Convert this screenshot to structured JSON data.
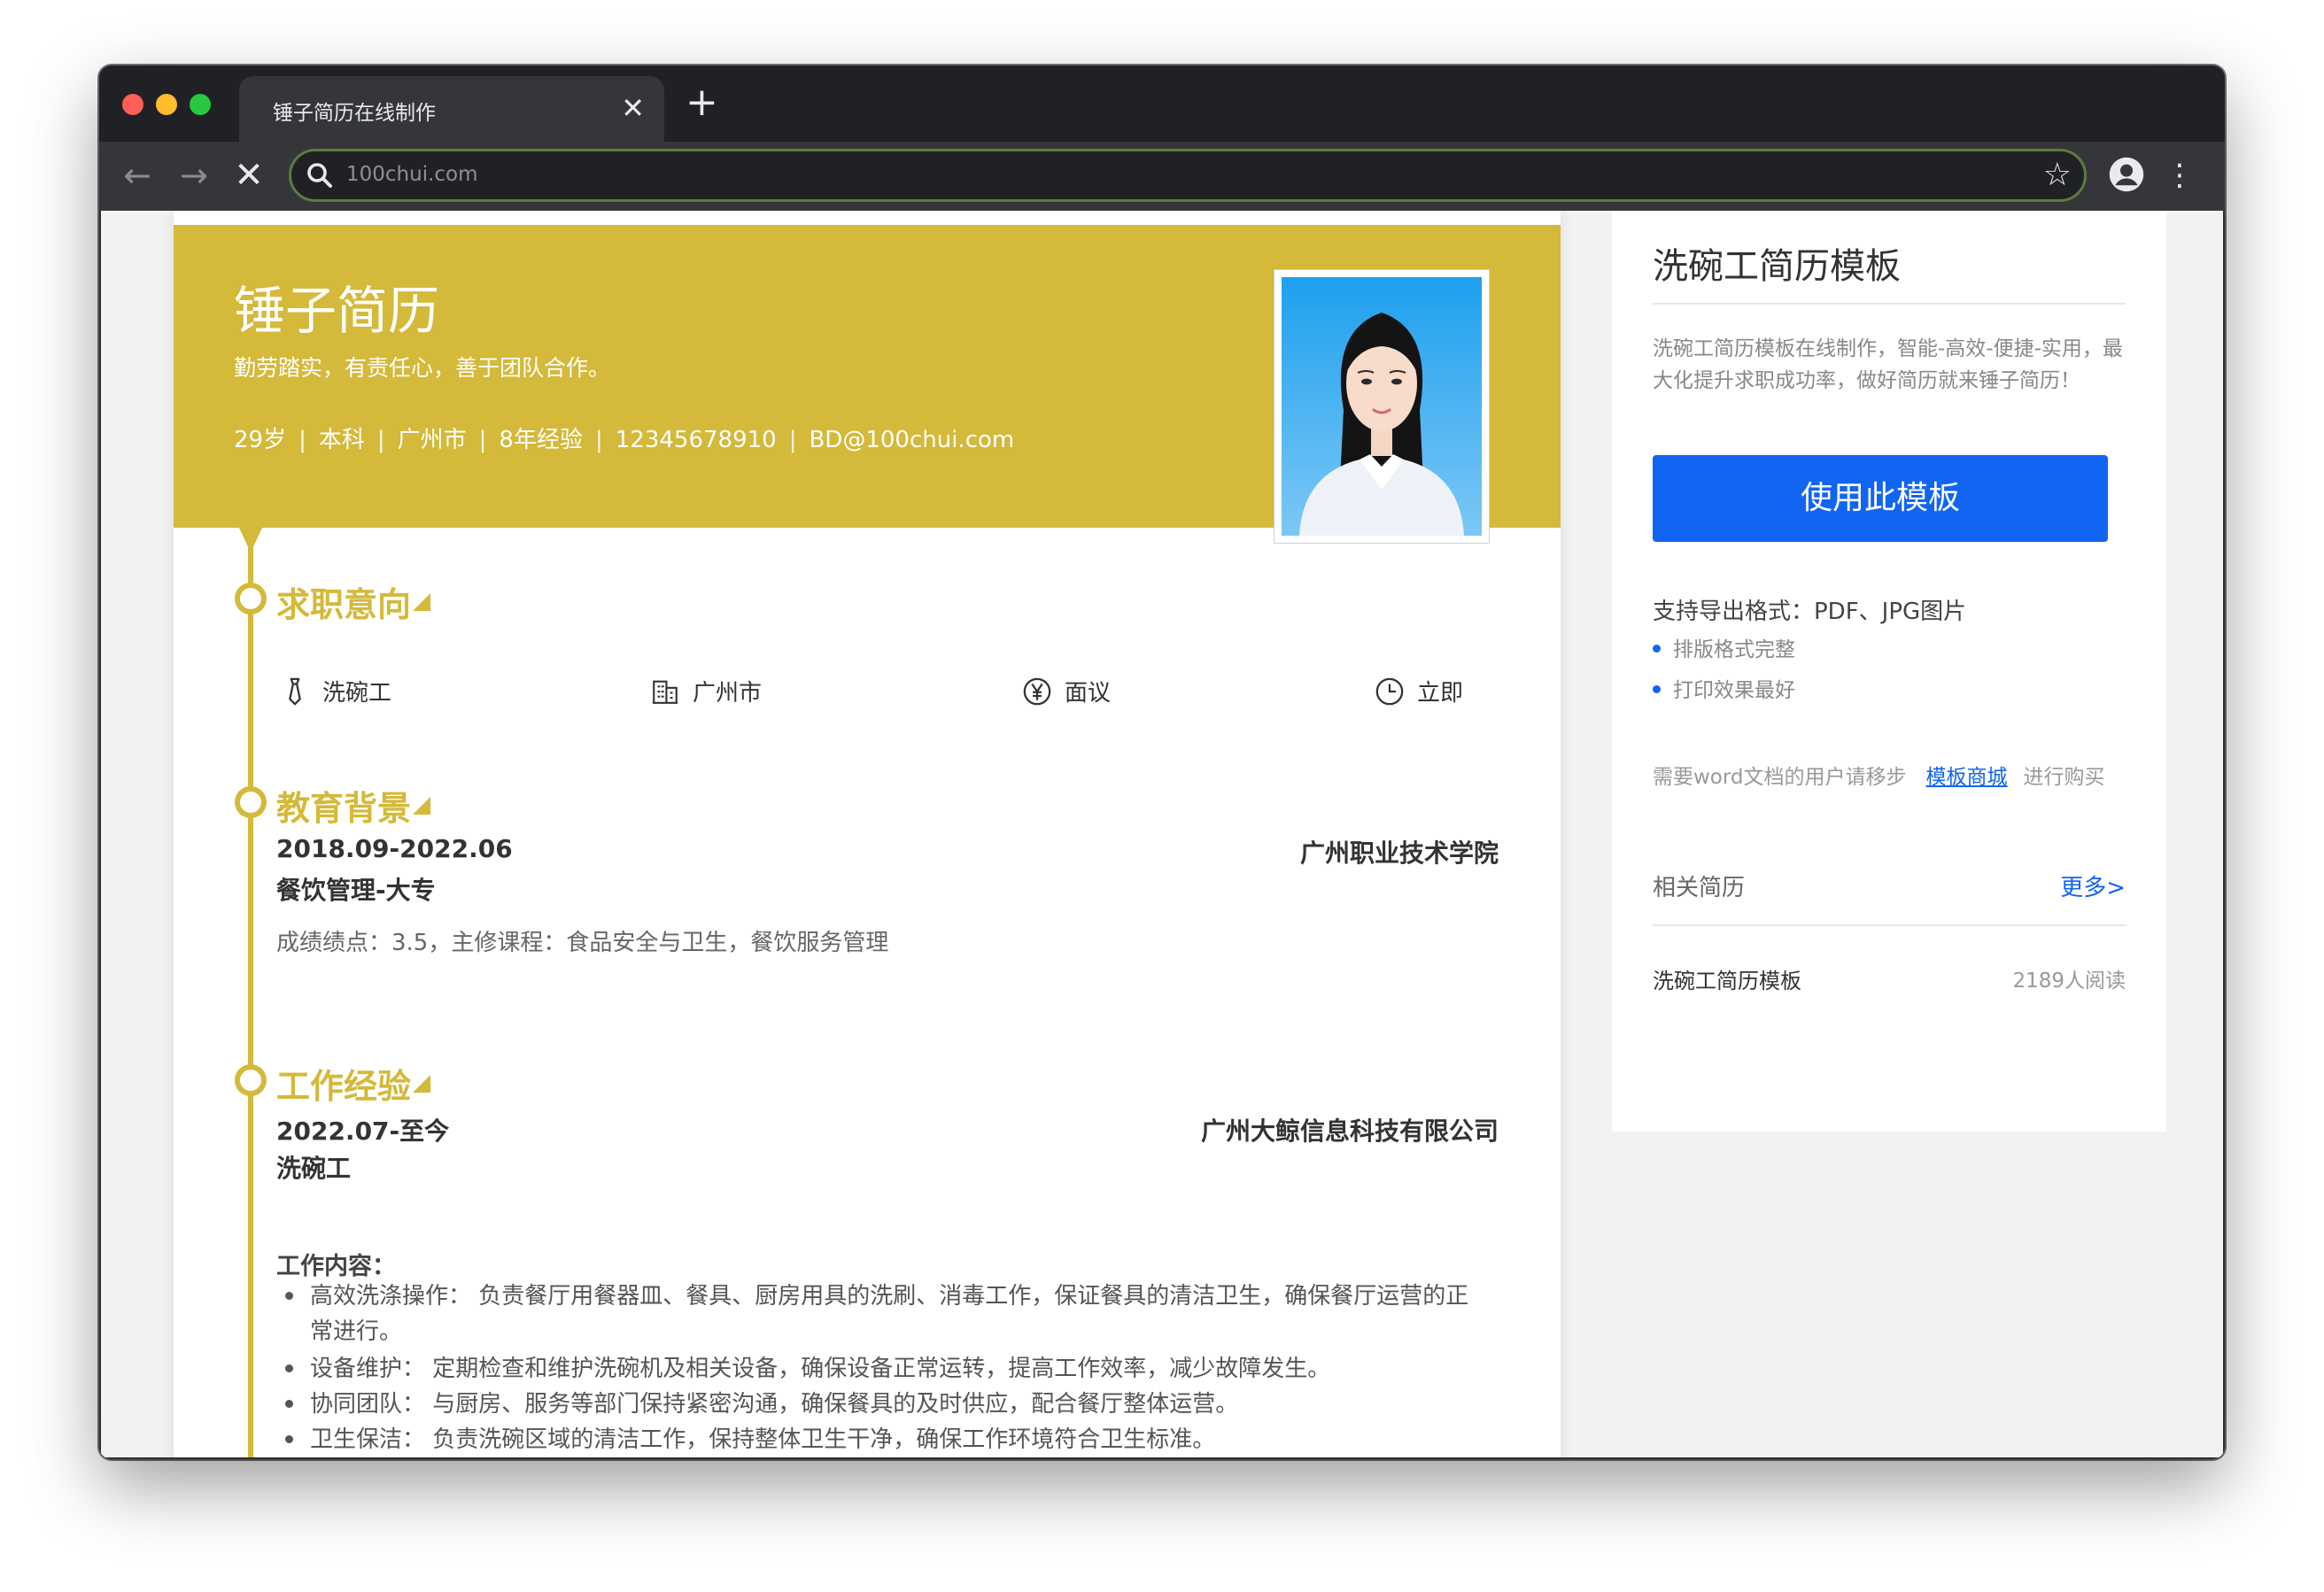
{
  "browser": {
    "tab_title": "锤子简历在线制作",
    "tab_close": "✕",
    "new_tab": "+",
    "address": "100chui.com",
    "back": "←",
    "forward": "→",
    "stop": "✕",
    "star": "☆",
    "menu": "⋮",
    "omnibox_border_color": "#5a7d3c"
  },
  "resume": {
    "accent_color": "#d4b93a",
    "name": "锤子简历",
    "motto": "勤劳踏实，有责任心，善于团队合作。",
    "info": [
      "29岁",
      "本科",
      "广州市",
      "8年经验",
      "12345678910",
      "BD@100chui.com"
    ],
    "info_sep": "|",
    "sections": {
      "intent": {
        "title": "求职意向",
        "items": [
          {
            "icon": "tie-icon",
            "text": "洗碗工"
          },
          {
            "icon": "building-icon",
            "text": "广州市"
          },
          {
            "icon": "yen-icon",
            "text": "面议"
          },
          {
            "icon": "clock-icon",
            "text": "立即"
          }
        ]
      },
      "education": {
        "title": "教育背景",
        "period": "2018.09-2022.06",
        "school": "广州职业技术学院",
        "major": "餐饮管理-大专",
        "detail": "成绩绩点：3.5，主修课程：食品安全与卫生，餐饮服务管理"
      },
      "work": {
        "title": "工作经验",
        "period": "2022.07-至今",
        "company": "广州大鲸信息科技有限公司",
        "role": "洗碗工",
        "content_title": "工作内容：",
        "bullets": [
          "高效洗涤操作： 负责餐厅用餐器皿、餐具、厨房用具的洗刷、消毒工作，保证餐具的清洁卫生，确保餐厅运营的正常进行。",
          "设备维护： 定期检查和维护洗碗机及相关设备，确保设备正常运转，提高工作效率，减少故障发生。",
          "协同团队： 与厨房、服务等部门保持紧密沟通，确保餐具的及时供应，配合餐厅整体运营。",
          "卫生保洁： 负责洗碗区域的清洁工作，保持整体卫生干净，确保工作环境符合卫生标准。"
        ]
      }
    }
  },
  "sidebar": {
    "title": "洗碗工简历模板",
    "desc": "洗碗工简历模板在线制作，智能-高效-便捷-实用，最大化提升求职成功率，做好简历就来锤子简历！",
    "use_button": "使用此模板",
    "button_color": "#1165f0",
    "export_formats": "支持导出格式：PDF、JPG图片",
    "features": [
      "排版格式完整",
      "打印效果最好"
    ],
    "word_prefix": "需要word文档的用户请移步",
    "word_link": "模板商城",
    "word_suffix": "进行购买",
    "related_title": "相关简历",
    "more": "更多>",
    "related_items": [
      {
        "name": "洗碗工简历模板",
        "reads": "2189人阅读"
      }
    ]
  }
}
